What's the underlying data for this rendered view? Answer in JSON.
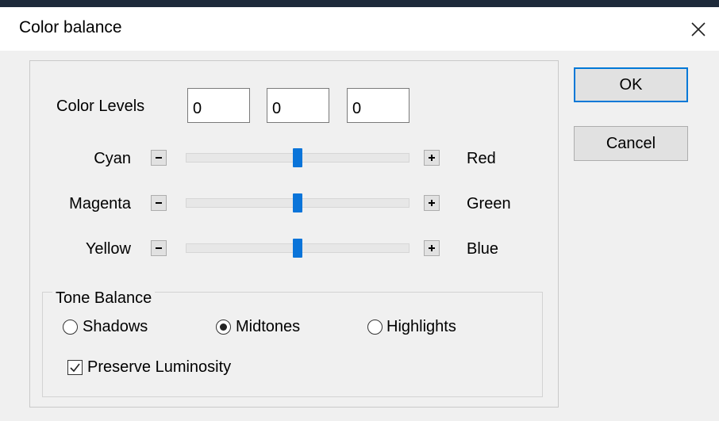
{
  "dialog": {
    "title": "Color balance",
    "close_icon": "close-icon"
  },
  "color_levels": {
    "label": "Color Levels",
    "values": [
      "0",
      "0",
      "0"
    ]
  },
  "sliders": [
    {
      "left_label": "Cyan",
      "right_label": "Red",
      "level": 0.5
    },
    {
      "left_label": "Magenta",
      "right_label": "Green",
      "level": 0.5
    },
    {
      "left_label": "Yellow",
      "right_label": "Blue",
      "level": 0.5
    }
  ],
  "tone_balance": {
    "legend": "Tone Balance",
    "options": [
      "Shadows",
      "Midtones",
      "Highlights"
    ],
    "selected": "Midtones",
    "preserve_luminosity_label": "Preserve Luminosity",
    "preserve_luminosity_checked": true
  },
  "buttons": {
    "ok": "OK",
    "cancel": "Cancel"
  },
  "colors": {
    "slider_thumb": "#0a74d9",
    "default_button_border": "#0078d7"
  }
}
